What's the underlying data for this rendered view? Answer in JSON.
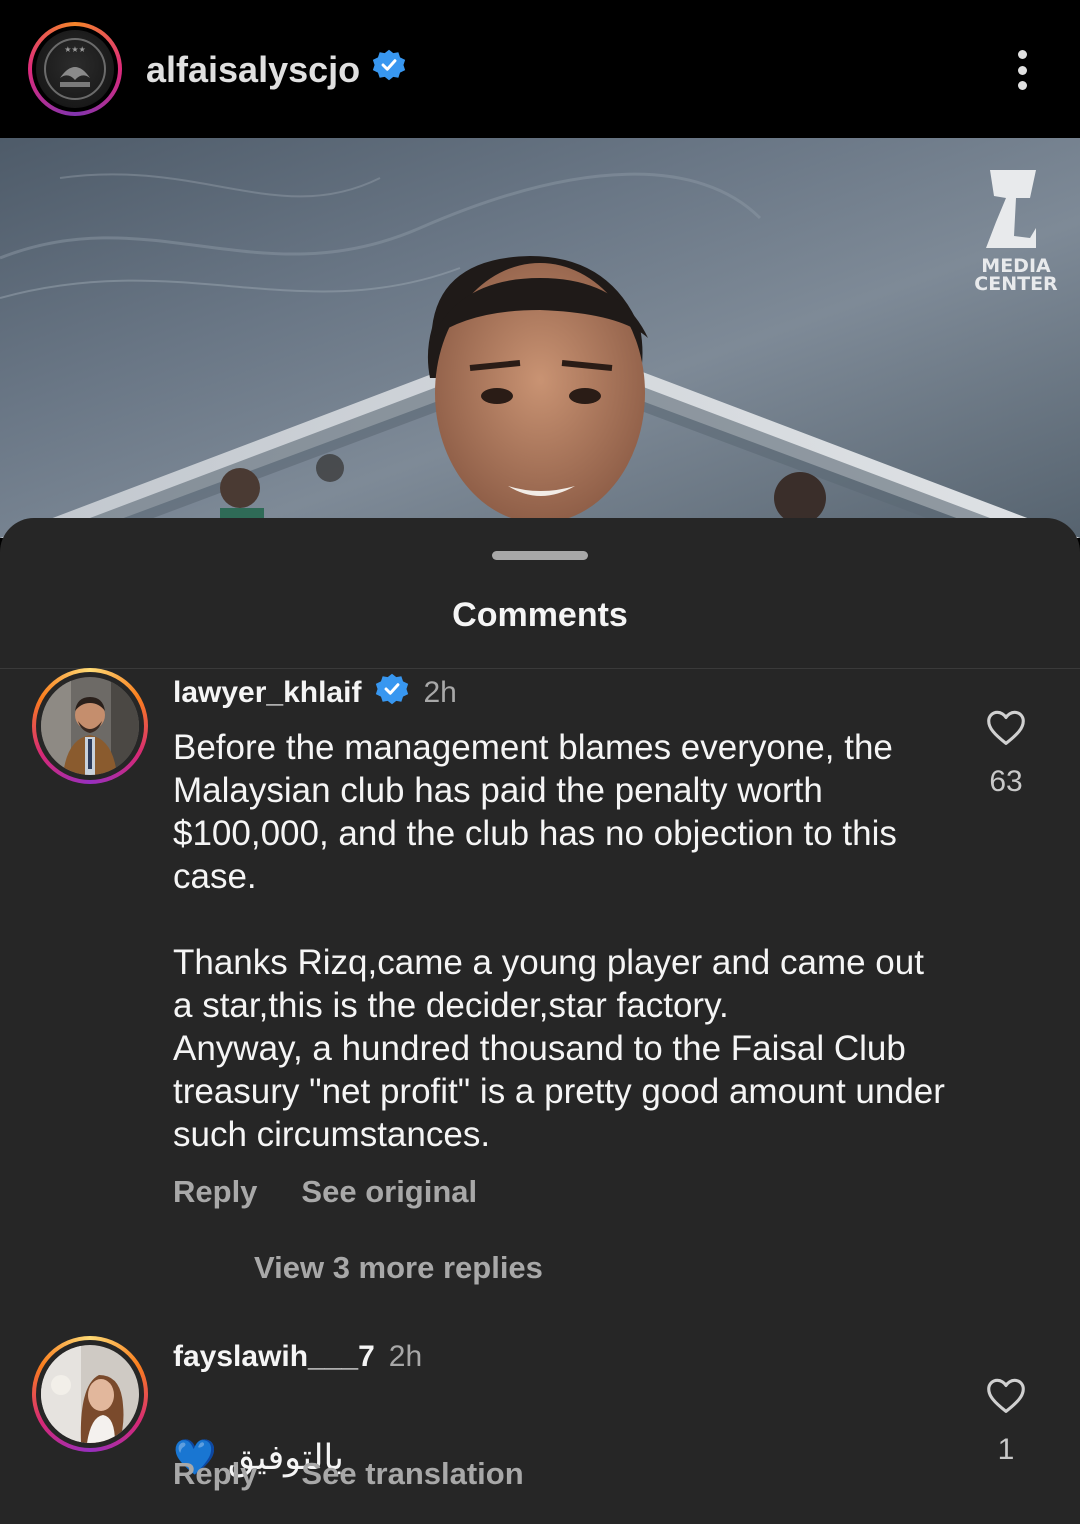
{
  "header": {
    "username": "alfaisalyscjo",
    "verified": true,
    "more_icon": "more-vertical-icon"
  },
  "post": {
    "watermark_line1": "MEDIA",
    "watermark_line2": "CENTER"
  },
  "sheet": {
    "title": "Comments"
  },
  "comments": [
    {
      "username": "lawyer_khlaif",
      "verified": true,
      "time": "2h",
      "text": "Before the management blames everyone, the Malaysian club has paid the penalty worth $100,000, and the club has no objection to this case.\n\nThanks Rizq,came a young player and came out a star,this is the decider,star factory.\nAnyway, a hundred thousand to the Faisal Club treasury \"net profit\" is a pretty good amount under such circumstances.",
      "reply_label": "Reply",
      "secondary_label": "See original",
      "likes": "63",
      "view_replies": "View 3 more replies"
    },
    {
      "username": "fayslawih___7",
      "verified": false,
      "time": "2h",
      "text": "بالتوفيق 💙",
      "reply_label": "Reply",
      "secondary_label": "See translation",
      "likes": "1"
    }
  ],
  "colors": {
    "sheet_bg": "#262626",
    "secondary_text": "#a8a8a8",
    "verified_blue": "#3897f0"
  }
}
